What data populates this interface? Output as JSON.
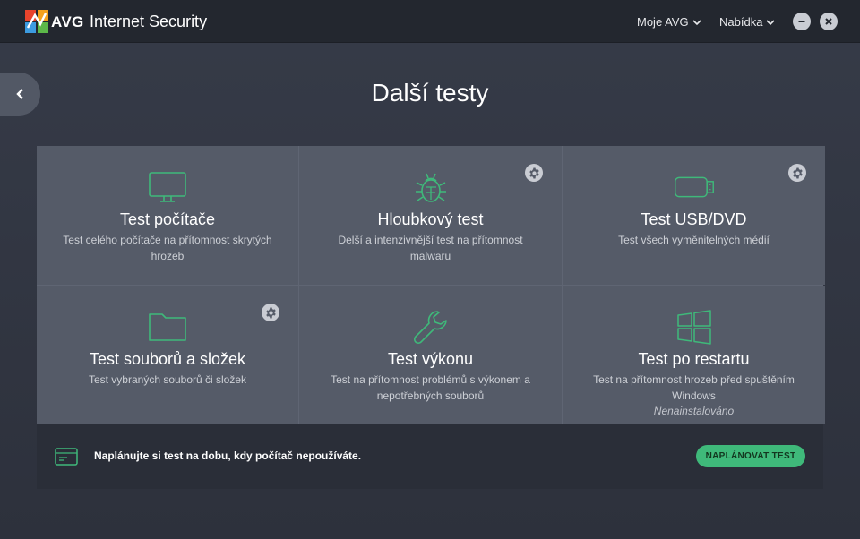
{
  "app": {
    "brand": "AVG",
    "product": "Internet Security"
  },
  "header": {
    "menu_my_avg": "Moje AVG",
    "menu_offer": "Nabídka"
  },
  "page": {
    "title": "Další testy"
  },
  "tiles": [
    {
      "title": "Test počítače",
      "desc": "Test celého počítače na přítomnost skrytých hrozeb",
      "icon": "monitor-icon",
      "has_settings": false
    },
    {
      "title": "Hloubkový test",
      "desc": "Delší a intenzivnější test na přítomnost malwaru",
      "icon": "bug-icon",
      "has_settings": true
    },
    {
      "title": "Test USB/DVD",
      "desc": "Test všech vyměnitelných médií",
      "icon": "usb-drive-icon",
      "has_settings": true
    },
    {
      "title": "Test souborů a složek",
      "desc": "Test vybraných souborů či složek",
      "icon": "folder-icon",
      "has_settings": true
    },
    {
      "title": "Test výkonu",
      "desc": "Test na přítomnost problémů s výkonem a nepotřebných souborů",
      "icon": "wrench-icon",
      "has_settings": false
    },
    {
      "title": "Test po restartu",
      "desc": "Test na přítomnost hrozeb před spuštěním Windows",
      "note": "Nenainstalováno",
      "icon": "windows-logo-icon",
      "has_settings": false
    }
  ],
  "schedule": {
    "text": "Naplánujte si test na dobu, kdy počítač nepoužíváte.",
    "button": "NAPLÁNOVAT TEST"
  },
  "colors": {
    "accent": "#3fb97a",
    "tile": "#555b68",
    "titlebar": "#23272f"
  }
}
